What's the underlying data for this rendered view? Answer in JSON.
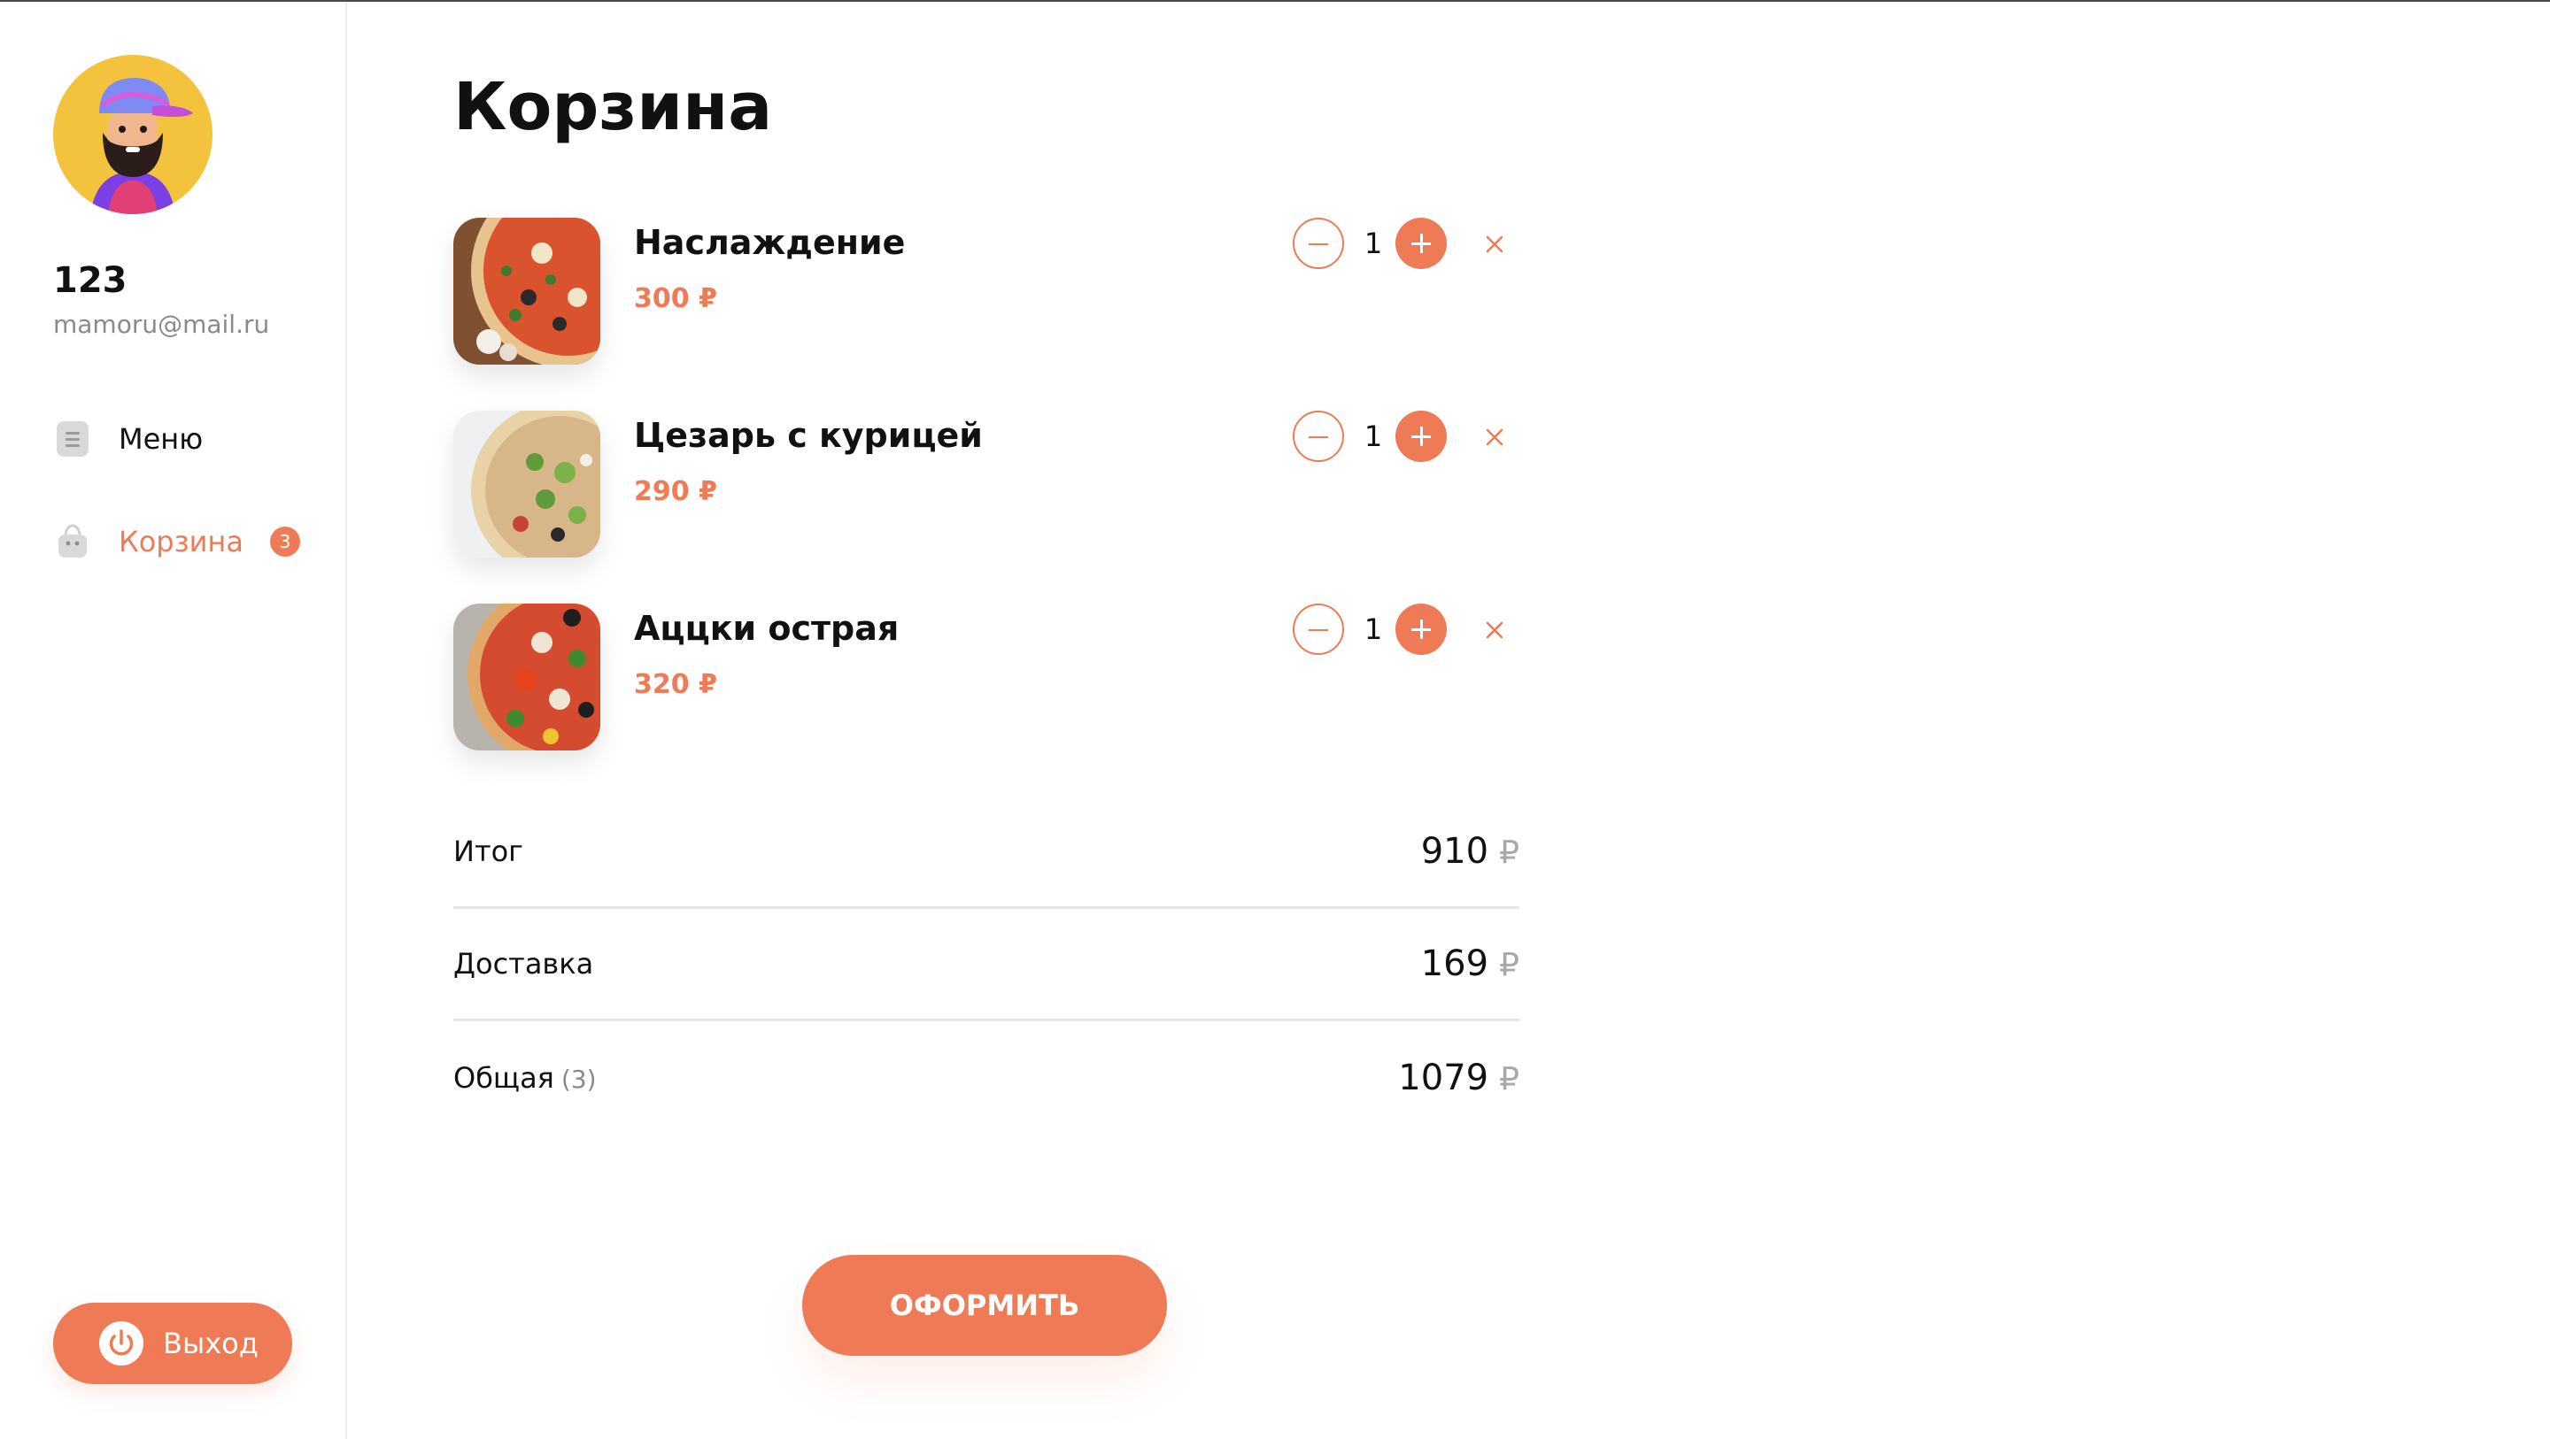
{
  "user": {
    "name": "123",
    "email": "mamoru@mail.ru"
  },
  "nav": {
    "menu_label": "Меню",
    "cart_label": "Корзина",
    "cart_badge": "3"
  },
  "logout_label": "Выход",
  "page_title": "Корзина",
  "currency_symbol": "₽",
  "cart_items": [
    {
      "name": "Наслаждение",
      "price": "300 ₽",
      "quantity": "1"
    },
    {
      "name": "Цезарь с курицей",
      "price": "290 ₽",
      "quantity": "1"
    },
    {
      "name": "Аццки острая",
      "price": "320 ₽",
      "quantity": "1"
    }
  ],
  "summary": {
    "subtotal_label": "Итог",
    "subtotal_value": "910",
    "delivery_label": "Доставка",
    "delivery_value": "169",
    "total_label": "Общая",
    "total_count": "(3)",
    "total_value": "1079"
  },
  "checkout_label": "ОФОРМИТЬ",
  "colors": {
    "accent": "#ee7b55",
    "text": "#111111",
    "muted": "#8a8a8a",
    "divider": "#e6e6e6"
  },
  "icons": [
    "menu-doc-icon",
    "shopping-bag-icon",
    "power-icon",
    "minus-icon",
    "plus-icon",
    "close-icon"
  ]
}
